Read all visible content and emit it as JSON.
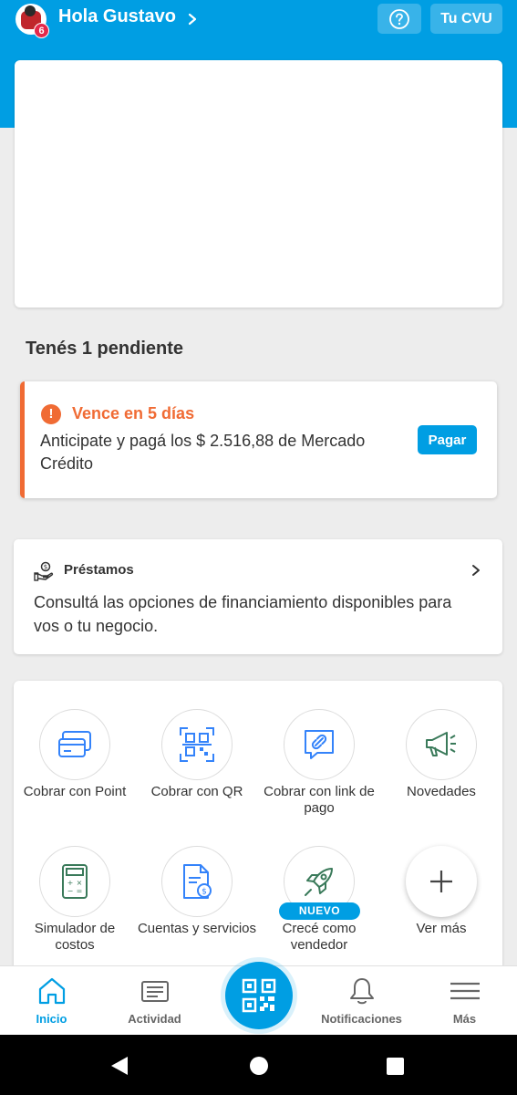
{
  "header": {
    "greeting": "Hola Gustavo",
    "level": "6",
    "cvu_label": "Tu CVU",
    "help_icon": "question-circle-icon",
    "accent_color": "#009ee3"
  },
  "pending": {
    "title": "Tenés 1 pendiente",
    "alert_label": "Vence en 5 días",
    "alert_text": "Anticipate y pagá los $ 2.516,88 de Mercado Crédito",
    "pay_label": "Pagar",
    "alert_color": "#f06b34"
  },
  "loans": {
    "title": "Préstamos",
    "text": "Consultá las opciones de financiamiento disponibles para vos o tu negocio."
  },
  "shortcuts": [
    {
      "label": "Cobrar con Point",
      "icon": "card-reader-icon"
    },
    {
      "label": "Cobrar con QR",
      "icon": "qr-icon"
    },
    {
      "label": "Cobrar con link de pago",
      "icon": "link-chat-icon"
    },
    {
      "label": "Novedades",
      "icon": "megaphone-icon"
    },
    {
      "label": "Simulador de costos",
      "icon": "calculator-icon"
    },
    {
      "label": "Cuentas y servicios",
      "icon": "bill-icon"
    },
    {
      "label": "Crecé como vendedor",
      "icon": "rocket-icon",
      "badge": "NUEVO"
    },
    {
      "label": "Ver más",
      "icon": "plus-icon"
    }
  ],
  "nav": {
    "items": [
      {
        "label": "Inicio",
        "icon": "home-icon",
        "active": true
      },
      {
        "label": "Actividad",
        "icon": "activity-icon"
      },
      {
        "label": "Notificaciones",
        "icon": "bell-icon"
      },
      {
        "label": "Más",
        "icon": "menu-icon"
      }
    ],
    "fab_icon": "qr-scan-icon"
  }
}
